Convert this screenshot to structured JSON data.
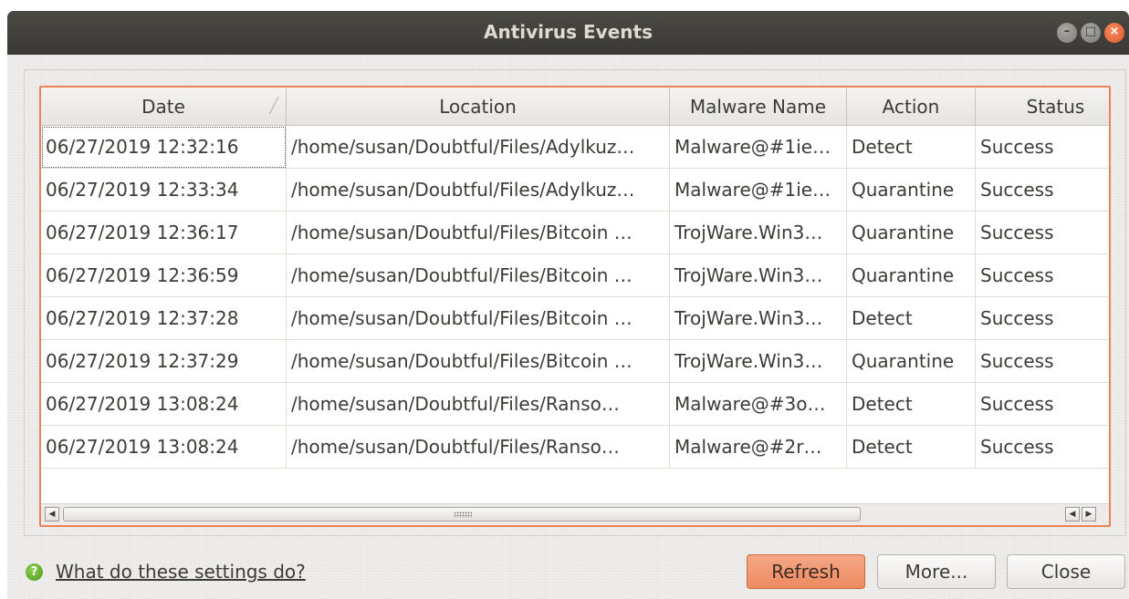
{
  "window": {
    "title": "Antivirus Events"
  },
  "table": {
    "columns": [
      "Date",
      "Location",
      "Malware Name",
      "Action",
      "Status"
    ],
    "rows": [
      [
        "06/27/2019 12:32:16",
        "/home/susan/Doubtful/Files/Adylkuz…",
        "Malware@#1ie…",
        "Detect",
        "Success"
      ],
      [
        "06/27/2019 12:33:34",
        "/home/susan/Doubtful/Files/Adylkuz…",
        "Malware@#1ie…",
        "Quarantine",
        "Success"
      ],
      [
        "06/27/2019 12:36:17",
        "/home/susan/Doubtful/Files/Bitcoin …",
        "TrojWare.Win3…",
        "Quarantine",
        "Success"
      ],
      [
        "06/27/2019 12:36:59",
        "/home/susan/Doubtful/Files/Bitcoin …",
        "TrojWare.Win3…",
        "Quarantine",
        "Success"
      ],
      [
        "06/27/2019 12:37:28",
        "/home/susan/Doubtful/Files/Bitcoin …",
        "TrojWare.Win3…",
        "Detect",
        "Success"
      ],
      [
        "06/27/2019 12:37:29",
        "/home/susan/Doubtful/Files/Bitcoin …",
        "TrojWare.Win3…",
        "Quarantine",
        "Success"
      ],
      [
        "06/27/2019 13:08:24",
        "/home/susan/Doubtful/Files/Ranso…",
        "Malware@#3o…",
        "Detect",
        "Success"
      ],
      [
        "06/27/2019 13:08:24",
        "/home/susan/Doubtful/Files/Ranso…",
        "Malware@#2r…",
        "Detect",
        "Success"
      ]
    ]
  },
  "footer": {
    "help_link": "What do these settings do?",
    "refresh_label": "Refresh",
    "more_label": "More...",
    "close_label": "Close"
  },
  "colors": {
    "accent": "#e9835a",
    "titlebar": "#3c3b37",
    "close_button": "#e9602f"
  },
  "icons": {
    "minimize": "minimize-icon",
    "maximize": "maximize-icon",
    "close": "close-icon",
    "sort": "sort-ascending-icon",
    "help": "help-icon"
  }
}
